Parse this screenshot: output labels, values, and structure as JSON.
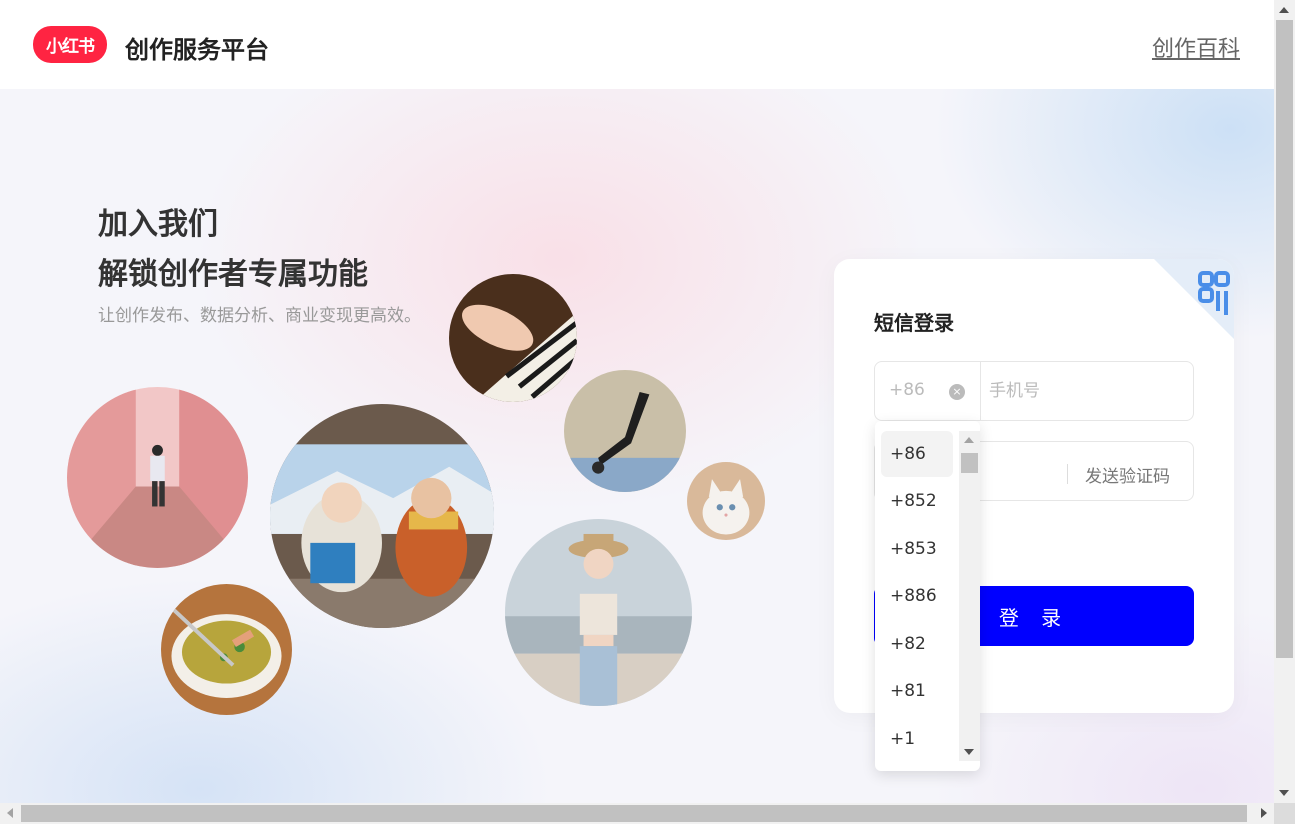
{
  "header": {
    "logo_text": "小红书",
    "platform_title": "创作服务平台",
    "wiki_link": "创作百科"
  },
  "hero": {
    "line1": "加入我们",
    "line2": "解锁创作者专属功能",
    "subtitle": "让创作发布、数据分析、商业变现更高效。"
  },
  "photos": [
    "piano-photo",
    "street-photo",
    "yoga-photo",
    "friends-photo",
    "cat-photo",
    "food-photo",
    "beach-photo"
  ],
  "login": {
    "title": "短信登录",
    "country_code": "+86",
    "phone_placeholder": "手机号",
    "send_code": "发送验证码",
    "login_button": "登 录"
  },
  "country_code_options": [
    "+86",
    "+852",
    "+853",
    "+886",
    "+82",
    "+81",
    "+1"
  ],
  "colors": {
    "brand_red": "#ff2442",
    "login_blue": "#0000ff",
    "qr_blue": "#4a8ee8"
  },
  "icons": {
    "qr_toggle": "qr-code-icon",
    "clear": "clear-circle-icon"
  }
}
